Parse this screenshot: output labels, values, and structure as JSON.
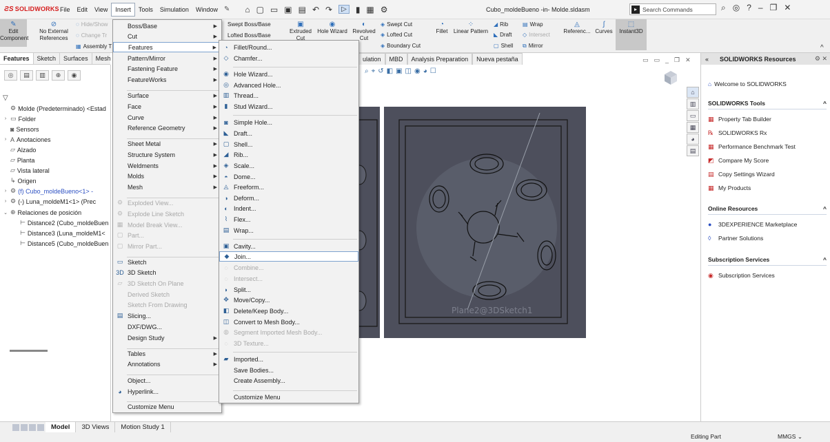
{
  "titlebar": {
    "brand": "SOLIDWORKS",
    "menus": [
      "File",
      "Edit",
      "View",
      "Insert",
      "Tools",
      "Simulation",
      "Window"
    ],
    "active_menu": "Insert",
    "doc_title": "Cubo_moldeBueno -in- Molde.sldasm",
    "search_placeholder": "Search Commands"
  },
  "commandmanager": {
    "edit_component": "Edit Component",
    "no_external_refs": "No External References",
    "hide_show": "Hide/Show",
    "change_transp": "Change Tr",
    "assembly": "Assembly T",
    "swept_boss": "Swept Boss/Base",
    "lofted_boss": "Lofted Boss/Base",
    "extruded": "Extruded",
    "hole_wizard": "Hole Wizard",
    "revolved": "Revolved",
    "cut": "Cut",
    "swept_cut": "Swept Cut",
    "lofted_cut": "Lofted Cut",
    "boundary_cut": "Boundary Cut",
    "fillet": "Fillet",
    "linear_pattern": "Linear Pattern",
    "rib": "Rib",
    "draft": "Draft",
    "shell": "Shell",
    "wrap": "Wrap",
    "intersect": "Intersect",
    "mirror": "Mirror",
    "reference": "Referenc...",
    "curves": "Curves",
    "instant3d": "Instant3D"
  },
  "tabs": [
    "Features",
    "Sketch",
    "Surfaces",
    "Mesh"
  ],
  "tabs_right": [
    "ulation",
    "MBD",
    "Analysis Preparation",
    "Nueva pestaña"
  ],
  "tree": [
    {
      "label": "Molde  (Predeterminado) <Estad",
      "icon": "assembly-icon",
      "arrow": ""
    },
    {
      "label": "Folder",
      "icon": "folder-icon",
      "arrow": "›"
    },
    {
      "label": "Sensors",
      "icon": "sensor-icon",
      "arrow": ""
    },
    {
      "label": "Anotaciones",
      "icon": "annotation-icon",
      "arrow": "›"
    },
    {
      "label": "Alzado",
      "icon": "plane-icon",
      "arrow": ""
    },
    {
      "label": "Planta",
      "icon": "plane-icon",
      "arrow": ""
    },
    {
      "label": "Vista lateral",
      "icon": "plane-icon",
      "arrow": ""
    },
    {
      "label": "Origen",
      "icon": "origin-icon",
      "arrow": ""
    },
    {
      "label": "(f) Cubo_moldeBueno<1> -",
      "icon": "part-icon",
      "arrow": "›"
    },
    {
      "label": "(-) Luna_moldeM1<1> (Prec",
      "icon": "part-icon",
      "arrow": "›"
    },
    {
      "label": "Relaciones de posición",
      "icon": "mate-icon",
      "arrow": "⌄"
    },
    {
      "label": "Distance2 (Cubo_moldeBuen",
      "icon": "distance-mate-icon",
      "arrow": ""
    },
    {
      "label": "Distance3 (Luna_moldeM1<",
      "icon": "distance-mate-icon",
      "arrow": ""
    },
    {
      "label": "Distance5 (Cubo_moldeBuen",
      "icon": "distance-mate-icon",
      "arrow": ""
    }
  ],
  "insert_menu": [
    {
      "label": "Boss/Base",
      "sub": true,
      "dis": false
    },
    {
      "label": "Cut",
      "sub": true,
      "dis": false
    },
    {
      "label": "Features",
      "sub": true,
      "dis": false,
      "hl": true
    },
    {
      "label": "Pattern/Mirror",
      "sub": true,
      "dis": false
    },
    {
      "label": "Fastening Feature",
      "sub": true,
      "dis": false
    },
    {
      "label": "FeatureWorks",
      "sub": true,
      "dis": false
    },
    {
      "label": "Surface",
      "sub": true,
      "dis": false
    },
    {
      "label": "Face",
      "sub": true,
      "dis": false
    },
    {
      "label": "Curve",
      "sub": true,
      "dis": false
    },
    {
      "label": "Reference Geometry",
      "sub": true,
      "dis": false
    },
    {
      "label": "Sheet Metal",
      "sub": true,
      "dis": false
    },
    {
      "label": "Structure System",
      "sub": true,
      "dis": false
    },
    {
      "label": "Weldments",
      "sub": true,
      "dis": false
    },
    {
      "label": "Molds",
      "sub": true,
      "dis": false
    },
    {
      "label": "Mesh",
      "sub": true,
      "dis": false
    },
    {
      "label": "Exploded View...",
      "sub": false,
      "dis": true
    },
    {
      "label": "Explode Line Sketch",
      "sub": false,
      "dis": true
    },
    {
      "label": "Model Break View...",
      "sub": false,
      "dis": true
    },
    {
      "label": "Part...",
      "sub": false,
      "dis": true
    },
    {
      "label": "Mirror Part...",
      "sub": false,
      "dis": true
    },
    {
      "label": "Sketch",
      "sub": false,
      "dis": false
    },
    {
      "label": "3D Sketch",
      "sub": false,
      "dis": false
    },
    {
      "label": "3D Sketch On Plane",
      "sub": false,
      "dis": true
    },
    {
      "label": "Derived Sketch",
      "sub": false,
      "dis": true
    },
    {
      "label": "Sketch From Drawing",
      "sub": false,
      "dis": true
    },
    {
      "label": "Slicing...",
      "sub": false,
      "dis": false
    },
    {
      "label": "DXF/DWG...",
      "sub": false,
      "dis": false
    },
    {
      "label": "Design Study",
      "sub": true,
      "dis": false
    },
    {
      "label": "Tables",
      "sub": true,
      "dis": false
    },
    {
      "label": "Annotations",
      "sub": true,
      "dis": false
    },
    {
      "label": "Object...",
      "sub": false,
      "dis": false
    },
    {
      "label": "Hyperlink...",
      "sub": false,
      "dis": false
    },
    {
      "label": "Customize Menu",
      "sub": false,
      "dis": false
    }
  ],
  "features_menu": [
    {
      "label": "Fillet/Round...",
      "dis": false
    },
    {
      "label": "Chamfer...",
      "dis": false
    },
    {
      "label": "Hole Wizard...",
      "dis": false
    },
    {
      "label": "Advanced Hole...",
      "dis": false
    },
    {
      "label": "Thread...",
      "dis": false
    },
    {
      "label": "Stud Wizard...",
      "dis": false
    },
    {
      "label": "Simple Hole...",
      "dis": false
    },
    {
      "label": "Draft...",
      "dis": false
    },
    {
      "label": "Shell...",
      "dis": false
    },
    {
      "label": "Rib...",
      "dis": false
    },
    {
      "label": "Scale...",
      "dis": false
    },
    {
      "label": "Dome...",
      "dis": false
    },
    {
      "label": "Freeform...",
      "dis": false
    },
    {
      "label": "Deform...",
      "dis": false
    },
    {
      "label": "Indent...",
      "dis": false
    },
    {
      "label": "Flex...",
      "dis": false
    },
    {
      "label": "Wrap...",
      "dis": false
    },
    {
      "label": "Cavity...",
      "dis": false
    },
    {
      "label": "Join...",
      "dis": false,
      "hl": true
    },
    {
      "label": "Combine...",
      "dis": true
    },
    {
      "label": "Intersect...",
      "dis": true
    },
    {
      "label": "Split...",
      "dis": false
    },
    {
      "label": "Move/Copy...",
      "dis": false
    },
    {
      "label": "Delete/Keep Body...",
      "dis": false
    },
    {
      "label": "Convert to Mesh Body...",
      "dis": false
    },
    {
      "label": "Segment Imported Mesh Body...",
      "dis": true
    },
    {
      "label": "3D Texture...",
      "dis": true
    },
    {
      "label": "Imported...",
      "dis": false
    },
    {
      "label": "Save Bodies...",
      "dis": false
    },
    {
      "label": "Create Assembly...",
      "dis": false
    },
    {
      "label": "Customize Menu",
      "dis": false
    }
  ],
  "viewport": {
    "plane_label": "Plane2@3DSketch1"
  },
  "taskpane": {
    "title": "SOLIDWORKS Resources",
    "welcome": "Welcome to SOLIDWORKS",
    "sections": [
      {
        "title": "SOLIDWORKS Tools",
        "items": [
          "Property Tab Builder",
          "SOLIDWORKS Rx",
          "Performance Benchmark Test",
          "Compare My Score",
          "Copy Settings Wizard",
          "My Products"
        ]
      },
      {
        "title": "Online Resources",
        "items": [
          "3DEXPERIENCE Marketplace",
          "Partner Solutions"
        ]
      },
      {
        "title": "Subscription Services",
        "items": [
          "Subscription Services"
        ]
      }
    ]
  },
  "bottom_tabs": [
    "Model",
    "3D Views",
    "Motion Study 1"
  ],
  "status": {
    "mode": "Editing Part",
    "units": "MMGS"
  },
  "colors": {
    "part_fill": "#4d4f5c",
    "accent": "#2b4fc2",
    "brand": "#d51b1b"
  }
}
